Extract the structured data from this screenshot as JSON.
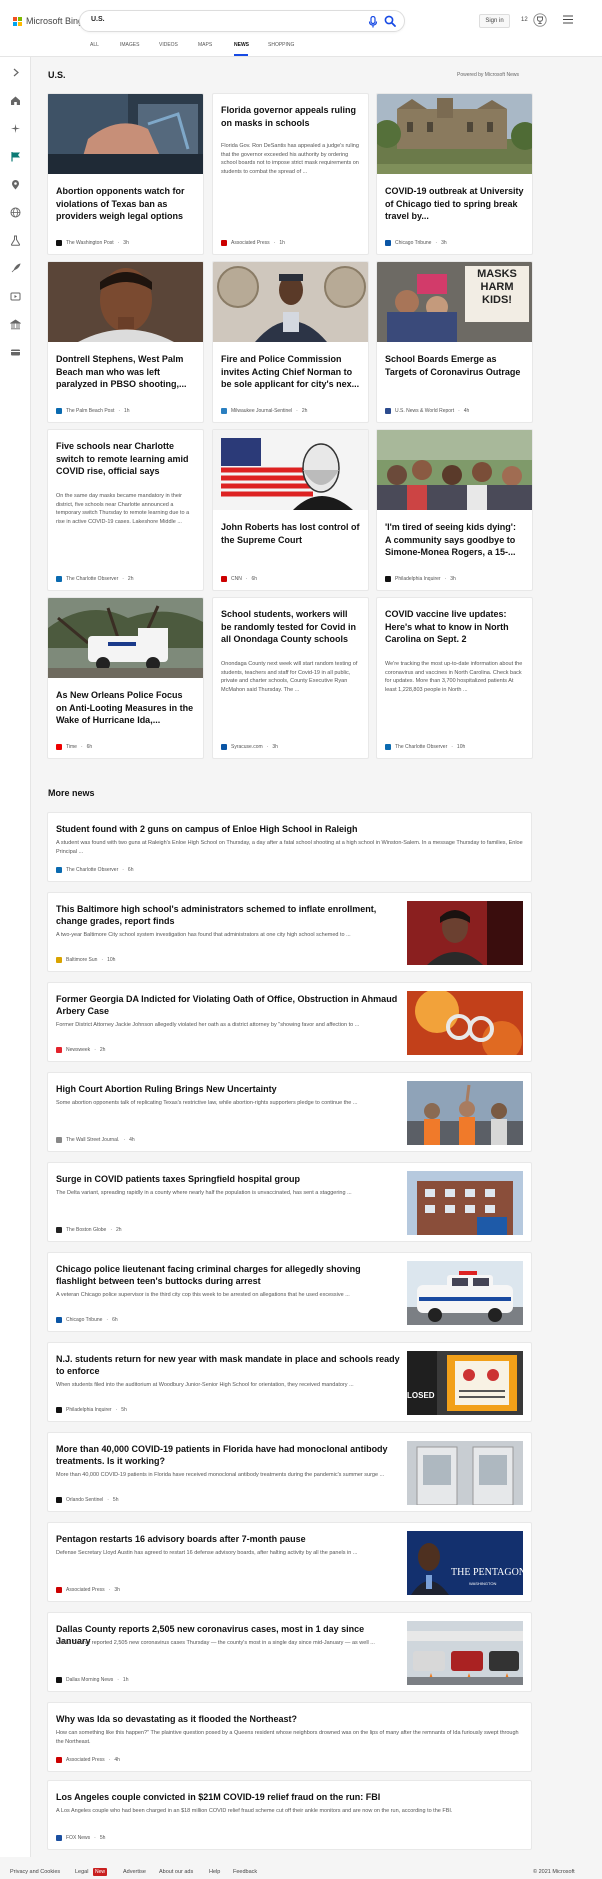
{
  "header": {
    "brand": "Microsoft Bing",
    "search_value": "U.S.",
    "signin": "Sign in",
    "rewards_count": "12",
    "nav": [
      "ALL",
      "IMAGES",
      "VIDEOS",
      "MAPS",
      "NEWS",
      "SHOPPING"
    ],
    "active_nav": "NEWS"
  },
  "section": {
    "title": "U.S.",
    "powered_by": "Powered by Microsoft News",
    "more_title": "More news"
  },
  "colors": {
    "accent": "#174ae4",
    "sidebar_flag": "#0b7a75",
    "new_badge": "#c91f1f"
  },
  "cards": [
    {
      "title": "Abortion opponents watch for violations of Texas ban as providers weigh legal options",
      "text": "",
      "source": "The Washington Post",
      "time": "3h"
    },
    {
      "title": "Florida governor appeals ruling on masks in schools",
      "text": "Florida Gov. Ron DeSantis has appealed a judge's ruling that the governor exceeded his authority by ordering school boards not to impose strict mask requirements on students to combat the spread of ...",
      "source": "Associated Press",
      "time": "1h"
    },
    {
      "title": "COVID-19 outbreak at University of Chicago tied to spring break travel by...",
      "text": "",
      "source": "Chicago Tribune",
      "time": "3h"
    },
    {
      "title": "Dontrell Stephens, West Palm Beach man who was left paralyzed in PBSO shooting,...",
      "text": "",
      "source": "The Palm Beach Post",
      "time": "1h"
    },
    {
      "title": "Fire and Police Commission invites Acting Chief Norman to be sole applicant for city's nex...",
      "text": "",
      "source": "Milwaukee Journal-Sentinel",
      "time": "2h"
    },
    {
      "title": "School Boards Emerge as Targets of Coronavirus Outrage",
      "text": "",
      "source": "U.S. News & World Report",
      "time": "4h"
    },
    {
      "title": "Five schools near Charlotte switch to remote learning amid COVID rise, official says",
      "text": "On the same day masks became mandatory in their district, five schools near Charlotte announced a temporary switch Thursday to remote learning due to a rise in active COVID-19 cases. Lakeshore Middle ...",
      "source": "The Charlotte Observer",
      "time": "2h"
    },
    {
      "title": "John Roberts has lost control of the Supreme Court",
      "text": "",
      "source": "CNN",
      "time": "6h"
    },
    {
      "title": "'I'm tired of seeing kids dying': A community says goodbye to Simone-Monea Rogers, a 15-...",
      "text": "",
      "source": "Philadelphia Inquirer",
      "time": "3h"
    },
    {
      "title": "As New Orleans Police Focus on Anti-Looting Measures in the Wake of Hurricane Ida,...",
      "text": "",
      "source": "Time",
      "time": "6h"
    },
    {
      "title": "School students, workers will be randomly tested for Covid in all Onondaga County schools",
      "text": "Onondaga County next week will start random testing of students, teachers and staff for Covid-19 in all public, private and charter schools, County Executive Ryan McMahon said Thursday. The ...",
      "source": "Syracuse.com",
      "time": "3h"
    },
    {
      "title": "COVID vaccine live updates: Here's what to know in North Carolina on Sept. 2",
      "text": "We're tracking the most up-to-date information about the coronavirus and vaccines in North Carolina. Check back for updates. More than 3,700 hospitalized patients At least 1,228,803 people in North ...",
      "source": "The Charlotte Observer",
      "time": "10h"
    }
  ],
  "more_news": [
    {
      "title": "Student found with 2 guns on campus of Enloe High School in Raleigh",
      "text": "A student was found with two guns at Raleigh's Enloe High School on Thursday, a day after a fatal school shooting at a high school in Winston-Salem. In a message Thursday to families, Enloe Principal ...",
      "source": "The Charlotte Observer",
      "time": "6h"
    },
    {
      "title": "This Baltimore high school's administrators schemed to inflate enrollment, change grades, report finds",
      "text": "A two-year Baltimore City school system investigation has found that administrators at one city high school schemed to ...",
      "source": "Baltimore Sun",
      "time": "10h"
    },
    {
      "title": "Former Georgia DA Indicted for Violating Oath of Office, Obstruction in Ahmaud Arbery Case",
      "text": "Former District Attorney Jackie Johnson allegedly violated her oath as a district attorney by \"showing favor and affection to ...",
      "source": "Newsweek",
      "time": "2h"
    },
    {
      "title": "High Court Abortion Ruling Brings New Uncertainty",
      "text": "Some abortion opponents talk of replicating Texas's restrictive law, while abortion-rights supporters pledge to continue the ...",
      "source": "The Wall Street Journal.",
      "time": "4h"
    },
    {
      "title": "Surge in COVID patients taxes Springfield hospital group",
      "text": "The Delta variant, spreading rapidly in a county where nearly half the population is unvaccinated, has sent a staggering ...",
      "source": "The Boston Globe",
      "time": "2h"
    },
    {
      "title": "Chicago police lieutenant facing criminal charges for allegedly shoving flashlight between teen's buttocks during arrest",
      "text": "A veteran Chicago police supervisor is the third city cop this week to be arrested on allegations that he used excessive ...",
      "source": "Chicago Tribune",
      "time": "6h"
    },
    {
      "title": "N.J. students return for new year with mask mandate in place and schools ready to enforce",
      "text": "When students filed into the auditorium at Woodbury Junior-Senior High School for orientation, they received mandatory ...",
      "source": "Philadelphia Inquirer",
      "time": "5h"
    },
    {
      "title": "More than 40,000 COVID-19 patients in Florida have had monoclonal antibody treatments. Is it working?",
      "text": "More than 40,000 COVID-19 patients in Florida have received monoclonal antibody treatments during the pandemic's summer surge ...",
      "source": "Orlando Sentinel",
      "time": "5h"
    },
    {
      "title": "Pentagon restarts 16 advisory boards after 7-month pause",
      "text": "Defense Secretary Lloyd Austin has agreed to restart 16 defense advisory boards, after halting activity by all the panels in ...",
      "source": "Associated Press",
      "time": "3h"
    },
    {
      "title": "Dallas County reports 2,505 new coronavirus cases, most in 1 day since January",
      "text": "Dallas County reported 2,505 new coronavirus cases Thursday — the county's most in a single day since mid-January — as well ...",
      "source": "Dallas Morning News",
      "time": "1h"
    },
    {
      "title": "Why was Ida so devastating as it flooded the Northeast?",
      "text": "How can something like this happen?\" The plaintive question posed by a Queens resident whose neighbors drowned was on the lips of many after the remnants of Ida furiously swept through the Northeast.",
      "source": "Associated Press",
      "time": "4h"
    },
    {
      "title": "Los Angeles couple convicted in $21M COVID-19 relief fraud on the run: FBI",
      "text": "A Los Angeles couple who had been charged in an $18 million COVID relief fraud scheme cut off their ankle monitors and are now on the run, according to the FBI.",
      "source": "FOX News",
      "time": "5h"
    }
  ],
  "image_text": {
    "masks_sign": "MASKS HARM KIDS!",
    "pentagon_sign": "THE PENTAGON",
    "pentagon_sub": "WASHINGTON",
    "closed_sign": "LOSED"
  },
  "footer": {
    "links": [
      "Privacy and Cookies",
      "Legal",
      "Advertise",
      "About our ads",
      "Help",
      "Feedback"
    ],
    "new_badge": "New",
    "copyright": "© 2021 Microsoft"
  }
}
